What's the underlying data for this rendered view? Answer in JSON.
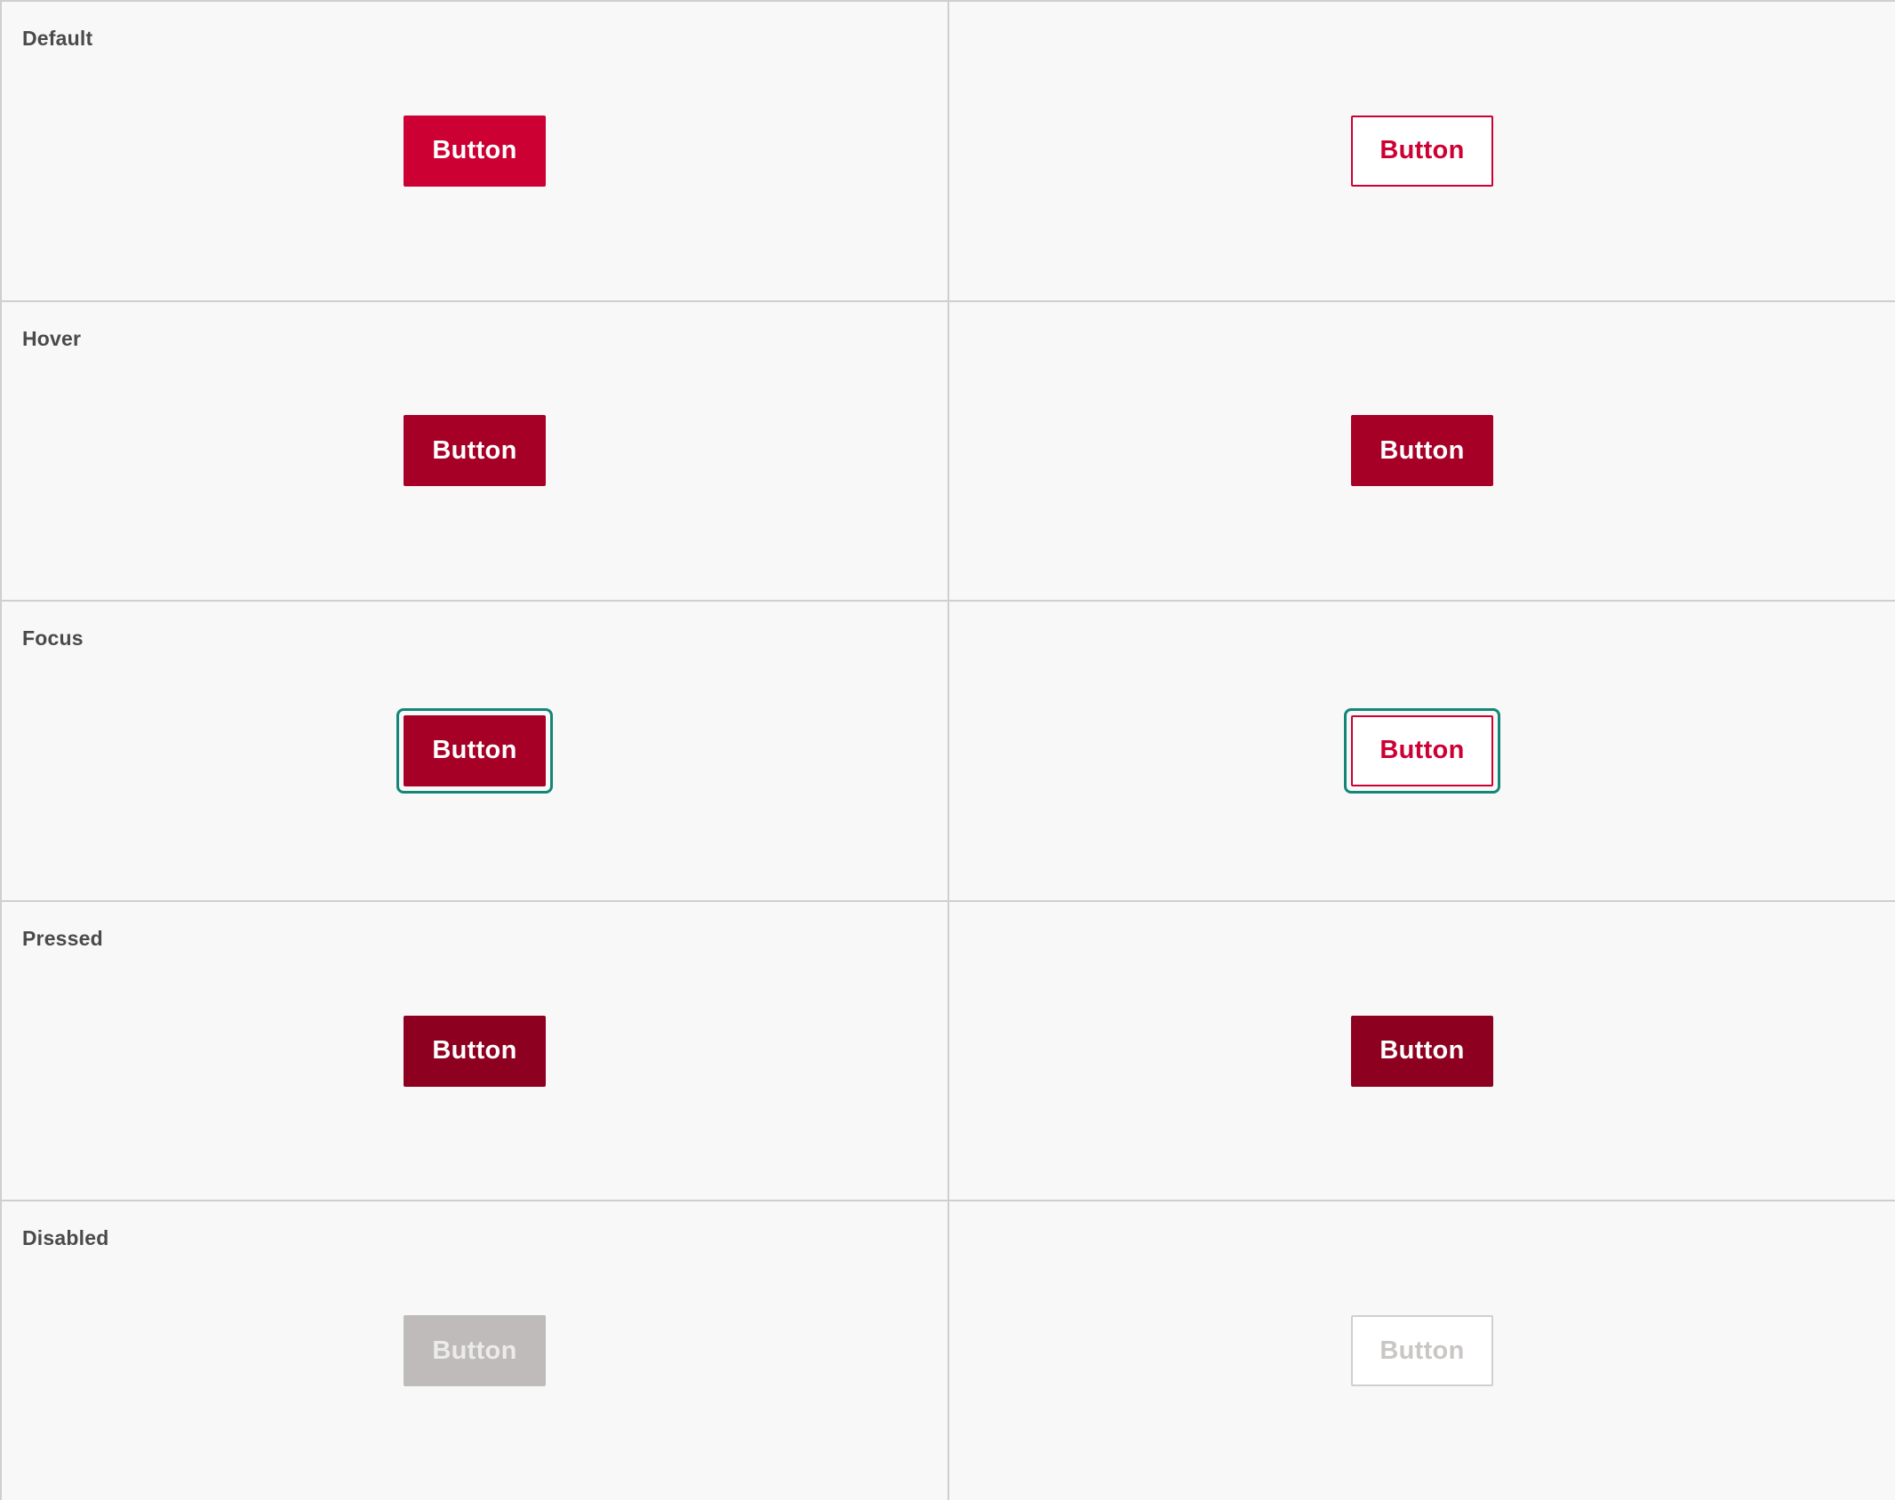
{
  "colors": {
    "primary": "#cc0033",
    "primary_hover": "#a60026",
    "primary_pressed": "#8e0020",
    "disabled_fill": "#bebbba",
    "focus_ring": "#138677",
    "border": "#cfcfcf"
  },
  "rows": [
    {
      "state": "Default",
      "primary_label": "Button",
      "secondary_label": "Button"
    },
    {
      "state": "Hover",
      "primary_label": "Button",
      "secondary_label": "Button"
    },
    {
      "state": "Focus",
      "primary_label": "Button",
      "secondary_label": "Button"
    },
    {
      "state": "Pressed",
      "primary_label": "Button",
      "secondary_label": "Button"
    },
    {
      "state": "Disabled",
      "primary_label": "Button",
      "secondary_label": "Button"
    }
  ]
}
